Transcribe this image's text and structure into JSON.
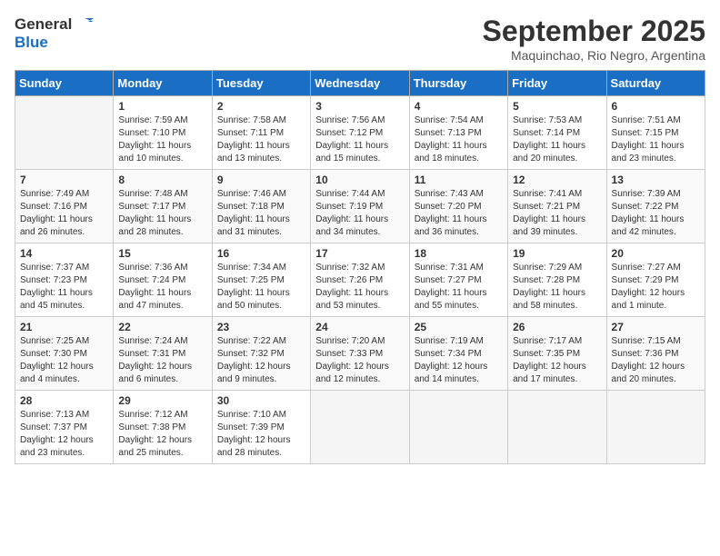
{
  "logo": {
    "line1": "General",
    "line2": "Blue"
  },
  "title": "September 2025",
  "subtitle": "Maquinchao, Rio Negro, Argentina",
  "weekdays": [
    "Sunday",
    "Monday",
    "Tuesday",
    "Wednesday",
    "Thursday",
    "Friday",
    "Saturday"
  ],
  "weeks": [
    [
      {
        "day": "",
        "info": ""
      },
      {
        "day": "1",
        "info": "Sunrise: 7:59 AM\nSunset: 7:10 PM\nDaylight: 11 hours\nand 10 minutes."
      },
      {
        "day": "2",
        "info": "Sunrise: 7:58 AM\nSunset: 7:11 PM\nDaylight: 11 hours\nand 13 minutes."
      },
      {
        "day": "3",
        "info": "Sunrise: 7:56 AM\nSunset: 7:12 PM\nDaylight: 11 hours\nand 15 minutes."
      },
      {
        "day": "4",
        "info": "Sunrise: 7:54 AM\nSunset: 7:13 PM\nDaylight: 11 hours\nand 18 minutes."
      },
      {
        "day": "5",
        "info": "Sunrise: 7:53 AM\nSunset: 7:14 PM\nDaylight: 11 hours\nand 20 minutes."
      },
      {
        "day": "6",
        "info": "Sunrise: 7:51 AM\nSunset: 7:15 PM\nDaylight: 11 hours\nand 23 minutes."
      }
    ],
    [
      {
        "day": "7",
        "info": "Sunrise: 7:49 AM\nSunset: 7:16 PM\nDaylight: 11 hours\nand 26 minutes."
      },
      {
        "day": "8",
        "info": "Sunrise: 7:48 AM\nSunset: 7:17 PM\nDaylight: 11 hours\nand 28 minutes."
      },
      {
        "day": "9",
        "info": "Sunrise: 7:46 AM\nSunset: 7:18 PM\nDaylight: 11 hours\nand 31 minutes."
      },
      {
        "day": "10",
        "info": "Sunrise: 7:44 AM\nSunset: 7:19 PM\nDaylight: 11 hours\nand 34 minutes."
      },
      {
        "day": "11",
        "info": "Sunrise: 7:43 AM\nSunset: 7:20 PM\nDaylight: 11 hours\nand 36 minutes."
      },
      {
        "day": "12",
        "info": "Sunrise: 7:41 AM\nSunset: 7:21 PM\nDaylight: 11 hours\nand 39 minutes."
      },
      {
        "day": "13",
        "info": "Sunrise: 7:39 AM\nSunset: 7:22 PM\nDaylight: 11 hours\nand 42 minutes."
      }
    ],
    [
      {
        "day": "14",
        "info": "Sunrise: 7:37 AM\nSunset: 7:23 PM\nDaylight: 11 hours\nand 45 minutes."
      },
      {
        "day": "15",
        "info": "Sunrise: 7:36 AM\nSunset: 7:24 PM\nDaylight: 11 hours\nand 47 minutes."
      },
      {
        "day": "16",
        "info": "Sunrise: 7:34 AM\nSunset: 7:25 PM\nDaylight: 11 hours\nand 50 minutes."
      },
      {
        "day": "17",
        "info": "Sunrise: 7:32 AM\nSunset: 7:26 PM\nDaylight: 11 hours\nand 53 minutes."
      },
      {
        "day": "18",
        "info": "Sunrise: 7:31 AM\nSunset: 7:27 PM\nDaylight: 11 hours\nand 55 minutes."
      },
      {
        "day": "19",
        "info": "Sunrise: 7:29 AM\nSunset: 7:28 PM\nDaylight: 11 hours\nand 58 minutes."
      },
      {
        "day": "20",
        "info": "Sunrise: 7:27 AM\nSunset: 7:29 PM\nDaylight: 12 hours\nand 1 minute."
      }
    ],
    [
      {
        "day": "21",
        "info": "Sunrise: 7:25 AM\nSunset: 7:30 PM\nDaylight: 12 hours\nand 4 minutes."
      },
      {
        "day": "22",
        "info": "Sunrise: 7:24 AM\nSunset: 7:31 PM\nDaylight: 12 hours\nand 6 minutes."
      },
      {
        "day": "23",
        "info": "Sunrise: 7:22 AM\nSunset: 7:32 PM\nDaylight: 12 hours\nand 9 minutes."
      },
      {
        "day": "24",
        "info": "Sunrise: 7:20 AM\nSunset: 7:33 PM\nDaylight: 12 hours\nand 12 minutes."
      },
      {
        "day": "25",
        "info": "Sunrise: 7:19 AM\nSunset: 7:34 PM\nDaylight: 12 hours\nand 14 minutes."
      },
      {
        "day": "26",
        "info": "Sunrise: 7:17 AM\nSunset: 7:35 PM\nDaylight: 12 hours\nand 17 minutes."
      },
      {
        "day": "27",
        "info": "Sunrise: 7:15 AM\nSunset: 7:36 PM\nDaylight: 12 hours\nand 20 minutes."
      }
    ],
    [
      {
        "day": "28",
        "info": "Sunrise: 7:13 AM\nSunset: 7:37 PM\nDaylight: 12 hours\nand 23 minutes."
      },
      {
        "day": "29",
        "info": "Sunrise: 7:12 AM\nSunset: 7:38 PM\nDaylight: 12 hours\nand 25 minutes."
      },
      {
        "day": "30",
        "info": "Sunrise: 7:10 AM\nSunset: 7:39 PM\nDaylight: 12 hours\nand 28 minutes."
      },
      {
        "day": "",
        "info": ""
      },
      {
        "day": "",
        "info": ""
      },
      {
        "day": "",
        "info": ""
      },
      {
        "day": "",
        "info": ""
      }
    ]
  ]
}
